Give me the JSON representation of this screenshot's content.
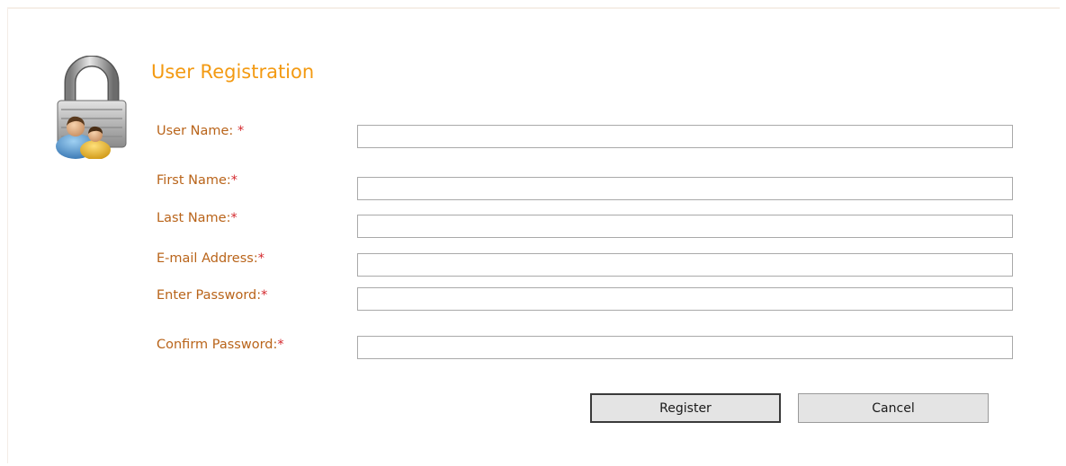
{
  "form": {
    "title": "User Registration",
    "required_marker": "*",
    "fields": [
      {
        "label": "User Name: ",
        "value": "",
        "placeholder": ""
      },
      {
        "label": "First Name:",
        "value": "",
        "placeholder": ""
      },
      {
        "label": "Last Name:",
        "value": "",
        "placeholder": ""
      },
      {
        "label": "E-mail Address:",
        "value": "",
        "placeholder": ""
      },
      {
        "label": "Enter Password:",
        "value": "",
        "placeholder": ""
      },
      {
        "label": "Confirm Password:",
        "value": "",
        "placeholder": ""
      }
    ],
    "buttons": {
      "register_label": "Register",
      "cancel_label": "Cancel"
    }
  },
  "icons": {
    "logo": "user-security-lock-icon"
  },
  "colors": {
    "title": "#f39a12",
    "label": "#b9641a",
    "required": "#d4282d",
    "field_border": "#a9a9a9",
    "button_bg": "#e4e4e4"
  }
}
